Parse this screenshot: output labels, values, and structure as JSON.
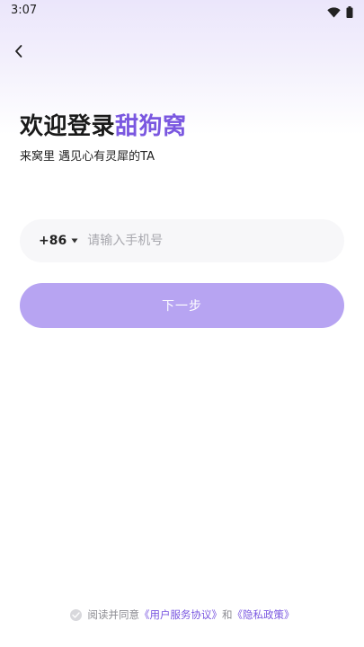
{
  "status_bar": {
    "time": "3:07"
  },
  "header": {
    "title_prefix": "欢迎登录",
    "title_brand": "甜狗窝",
    "subtitle": "来窝里  遇见心有灵犀的TA"
  },
  "phone": {
    "country_code": "+86",
    "placeholder": "请输入手机号",
    "value": ""
  },
  "next_button": {
    "label": "下一步"
  },
  "agreement": {
    "prefix": "阅读并同意",
    "user_agreement": "《用户服务协议》",
    "connector": "和",
    "privacy_policy": "《隐私政策》"
  },
  "colors": {
    "accent": "#7a57e0",
    "button": "#b7a4f2",
    "input_bg": "#f7f7f9"
  },
  "icons": {
    "back": "chevron-left-icon",
    "country_caret": "caret-down-icon",
    "wifi": "wifi-icon",
    "battery": "battery-icon",
    "check": "check-circle-icon"
  }
}
